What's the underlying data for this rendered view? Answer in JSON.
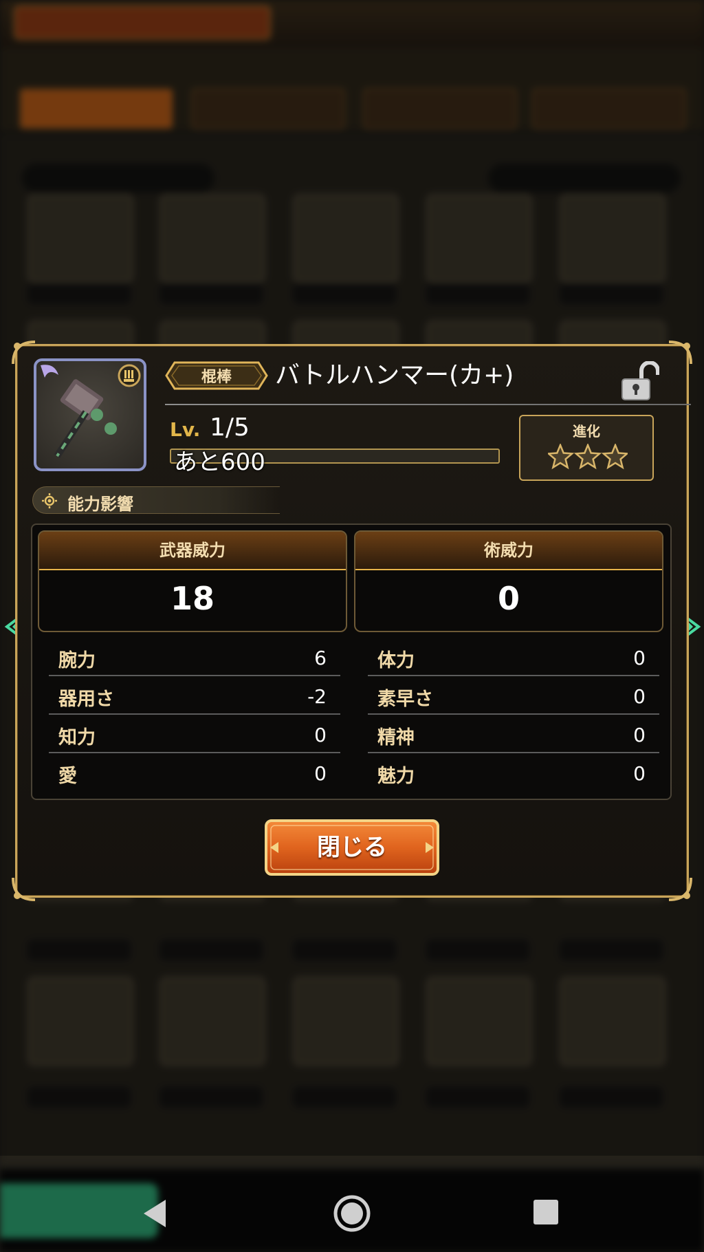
{
  "item": {
    "type_tag": "棍棒",
    "name": "バトルハンマー(カ+)",
    "level_label": "Lv.",
    "level_value": "1/5",
    "exp_text": "あと600",
    "exp_progress": 0.0,
    "evolution_label": "進化",
    "evolution_stars_total": 3,
    "evolution_stars_filled": 0
  },
  "section": {
    "title": "能力影響"
  },
  "power": [
    {
      "label": "武器威力",
      "value": "18"
    },
    {
      "label": "術威力",
      "value": "0"
    }
  ],
  "stats": {
    "left": [
      {
        "label": "腕力",
        "value": "6"
      },
      {
        "label": "器用さ",
        "value": "-2"
      },
      {
        "label": "知力",
        "value": "0"
      },
      {
        "label": "愛",
        "value": "0"
      }
    ],
    "right": [
      {
        "label": "体力",
        "value": "0"
      },
      {
        "label": "素早さ",
        "value": "0"
      },
      {
        "label": "精神",
        "value": "0"
      },
      {
        "label": "魅力",
        "value": "0"
      }
    ]
  },
  "close_button": {
    "label": "閉じる"
  },
  "colors": {
    "gold": "#c9a55a",
    "accent_orange": "#e0641e",
    "label_gold": "#f0d9a8",
    "nav_arrow": "#49d9a0"
  },
  "icons": {
    "lock": "unlocked-padlock-icon",
    "weapon": "battle-hammer-icon",
    "attribute_badge": "weapon-category-badge-icon",
    "section": "gear-sun-icon",
    "star": "star-outline-icon",
    "prev": "left-arrow-icon",
    "next": "right-arrow-icon"
  }
}
